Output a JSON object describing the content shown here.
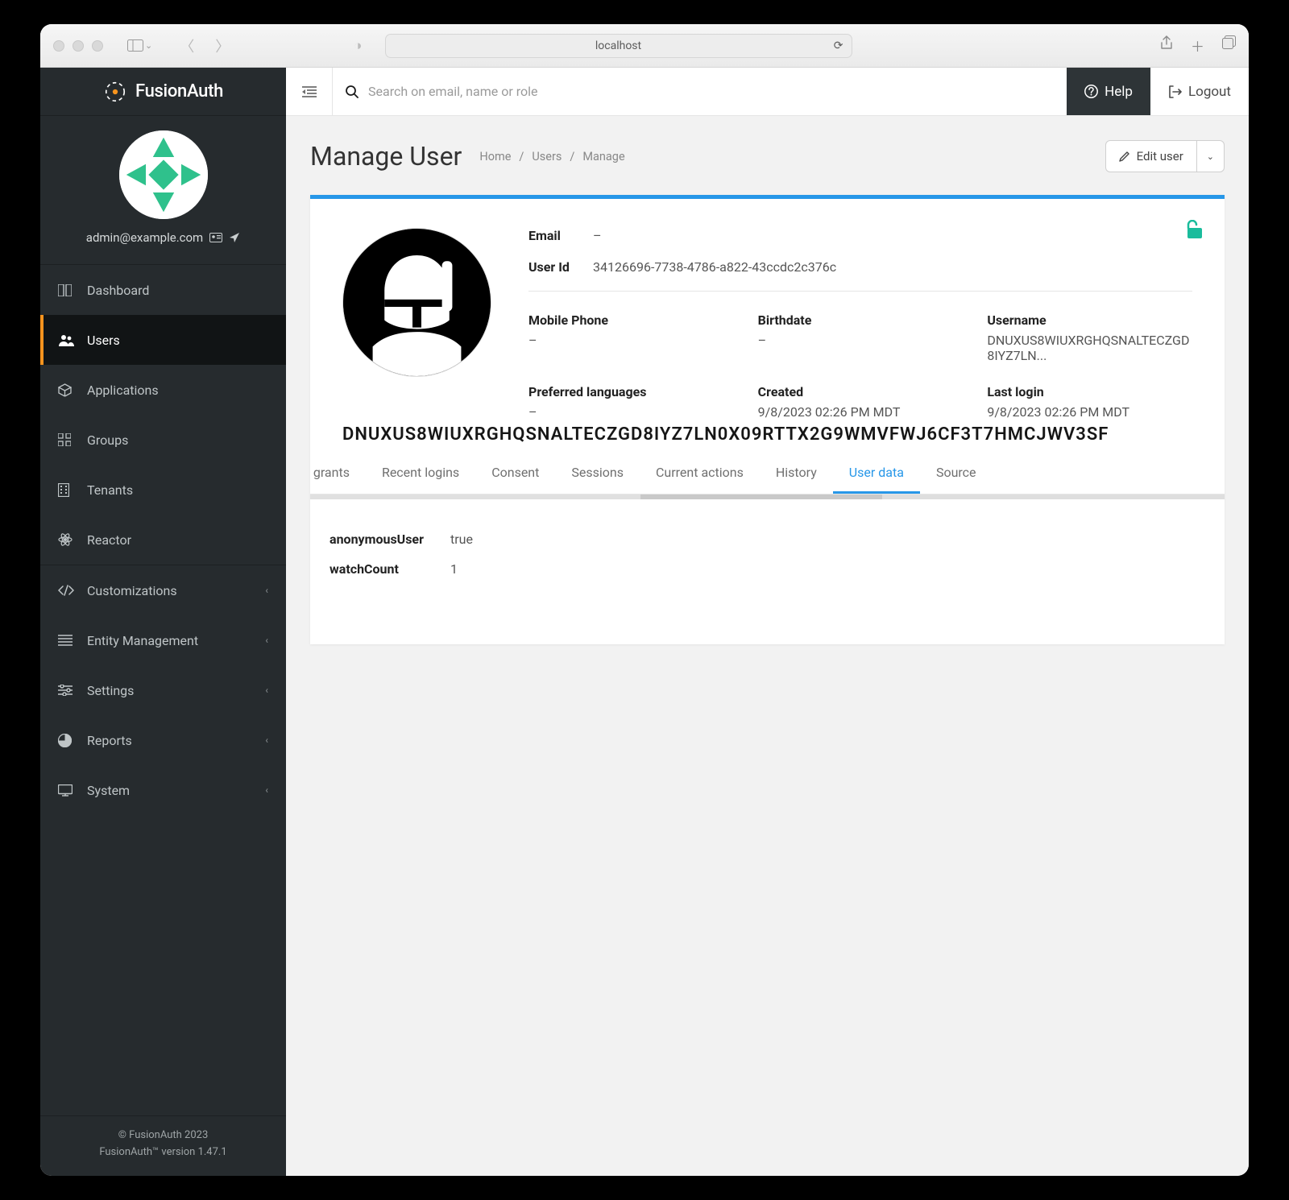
{
  "browser": {
    "address": "localhost"
  },
  "brand": {
    "name": "FusionAuth"
  },
  "profile": {
    "email": "admin@example.com"
  },
  "sidebar": {
    "items": [
      {
        "label": "Dashboard",
        "icon": "dashboard"
      },
      {
        "label": "Users",
        "icon": "users"
      },
      {
        "label": "Applications",
        "icon": "cube"
      },
      {
        "label": "Groups",
        "icon": "grid"
      },
      {
        "label": "Tenants",
        "icon": "building"
      },
      {
        "label": "Reactor",
        "icon": "reactor"
      },
      {
        "label": "Customizations",
        "icon": "code",
        "expandable": true
      },
      {
        "label": "Entity Management",
        "icon": "list",
        "expandable": true
      },
      {
        "label": "Settings",
        "icon": "sliders",
        "expandable": true
      },
      {
        "label": "Reports",
        "icon": "chart",
        "expandable": true
      },
      {
        "label": "System",
        "icon": "monitor",
        "expandable": true
      }
    ]
  },
  "footer": {
    "line1": "© FusionAuth 2023",
    "line2": "FusionAuth™ version 1.47.1"
  },
  "topbar": {
    "search_placeholder": "Search on email, name or role",
    "help": "Help",
    "logout": "Logout"
  },
  "page": {
    "title": "Manage User",
    "breadcrumbs": [
      "Home",
      "Users",
      "Manage"
    ],
    "edit_label": "Edit user"
  },
  "overlay_text": "DNUXUS8WIUXRGHQSNALTECZGD8IYZ7LN0X09RTTX2G9WMVFWJ6CF3T7HMCJWV3SF",
  "user": {
    "email_label": "Email",
    "email": "–",
    "userid_label": "User Id",
    "userid": "34126696-7738-4786-a822-43ccdc2c376c",
    "fields": [
      {
        "label": "Mobile Phone",
        "value": "–"
      },
      {
        "label": "Birthdate",
        "value": "–"
      },
      {
        "label": "Username",
        "value": "DNUXUS8WIUXRGHQSNALTECZGD8IYZ7LN..."
      },
      {
        "label": "Preferred languages",
        "value": "–"
      },
      {
        "label": "Created",
        "value": "9/8/2023 02:26 PM MDT"
      },
      {
        "label": "Last login",
        "value": "9/8/2023 02:26 PM MDT"
      }
    ]
  },
  "tabs": [
    "Entity grants",
    "Recent logins",
    "Consent",
    "Sessions",
    "Current actions",
    "History",
    "User data",
    "Source"
  ],
  "active_tab": "User data",
  "user_data": [
    {
      "key": "anonymousUser",
      "value": "true"
    },
    {
      "key": "watchCount",
      "value": "1"
    }
  ]
}
